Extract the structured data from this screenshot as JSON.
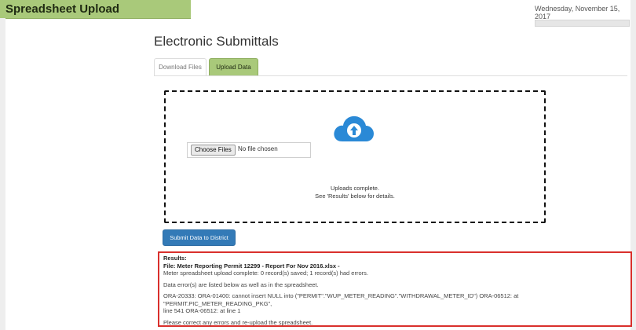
{
  "app": {
    "title": "Spreadsheet Upload",
    "accent": "#a9c97a"
  },
  "header": {
    "date": "Wednesday, November 15, 2017"
  },
  "main": {
    "title": "Electronic Submittals",
    "tabs": [
      {
        "label": "Download Files",
        "active": false
      },
      {
        "label": "Upload Data",
        "active": true
      }
    ]
  },
  "upload": {
    "choose_files_label": "Choose Files",
    "file_status": "No file chosen",
    "message_line1": "Uploads complete.",
    "message_line2": "See 'Results' below for details.",
    "icon": "cloud-upload-icon",
    "icon_color": "#2a89d6"
  },
  "submit": {
    "label": "Submit Data to District",
    "color": "#337ab7"
  },
  "results": {
    "heading": "Results:",
    "file_line": "File: Meter Reporting Permit 12299 - Report For Nov 2016.xlsx -",
    "summary": "Meter spreadsheet upload complete:  0 record(s) saved; 1 record(s) had errors.",
    "listed": "Data error(s) are listed below as well as in the spreadsheet.",
    "error_line1": "ORA-20333: ORA-01400: cannot insert NULL into (\"PERMIT\".\"WUP_METER_READING\".\"WITHDRAWAL_METER_ID\") ORA-06512: at \"PERMIT.PIC_METER_READING_PKG\",",
    "error_line2": "line 541 ORA-06512: at line 1",
    "instruction": "Please correct any errors and re-upload the spreadsheet.",
    "border_color": "#d9302c"
  }
}
